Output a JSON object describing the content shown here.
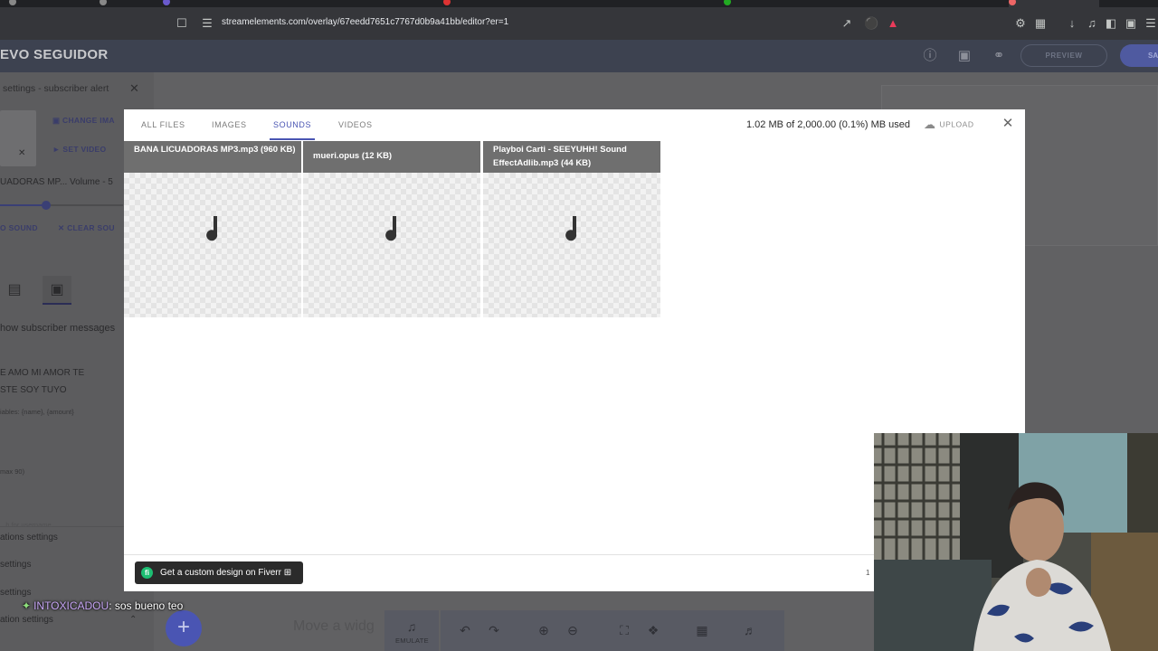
{
  "browser": {
    "url": "streamelements.com/overlay/67eedd7651c7767d0b9a41bb/editor?er=1"
  },
  "editor": {
    "title": "EVO SEGUIDOR",
    "preview_label": "PREVIEW",
    "save_label": "SA"
  },
  "left_panel": {
    "header": "settings - subscriber alert",
    "change_image": "CHANGE IMA",
    "set_video": "SET VIDEO",
    "sound_name": "UADORAS MP... Volume - 5",
    "set_sound": "O SOUND",
    "clear_sound": "CLEAR SOU",
    "show_messages": "how subscriber messages",
    "message_line1": "E AMO MI AMOR TE",
    "message_line2": "STE SOY TUYO",
    "variables": "iables: {name}, {amount}",
    "max_note": "max 90)",
    "username_note": "...h for username",
    "section1": "ations settings",
    "section2": "settings",
    "section3": "settings",
    "section4": "ation settings"
  },
  "chat": {
    "user": "INTOXICADOU",
    "message": ": sos bueno teo"
  },
  "bottom_toolbar": {
    "move_hint": "Move a widg",
    "emulate_label": "EMULATE"
  },
  "modal": {
    "tabs": [
      "ALL FILES",
      "IMAGES",
      "SOUNDS",
      "VIDEOS"
    ],
    "active_tab": "SOUNDS",
    "usage": "1.02 MB of 2,000.00 (0.1%) MB used",
    "upload_label": "UPLOAD",
    "files": [
      {
        "name": "BANA LICUADORAS MP3.mp3 (960 KB)"
      },
      {
        "name": "mueri.opus (12 KB)"
      },
      {
        "name": "Playboi Carti - SEEYUHH! Sound EffectAdlib.mp3 (44 KB)"
      }
    ],
    "fiverr_label": "Get a custom design on Fiverr",
    "page_number": "1"
  },
  "colors": {
    "accent": "#4a55b3",
    "file_header": "#6f6f6f",
    "fiverr_green": "#1dbf73"
  }
}
